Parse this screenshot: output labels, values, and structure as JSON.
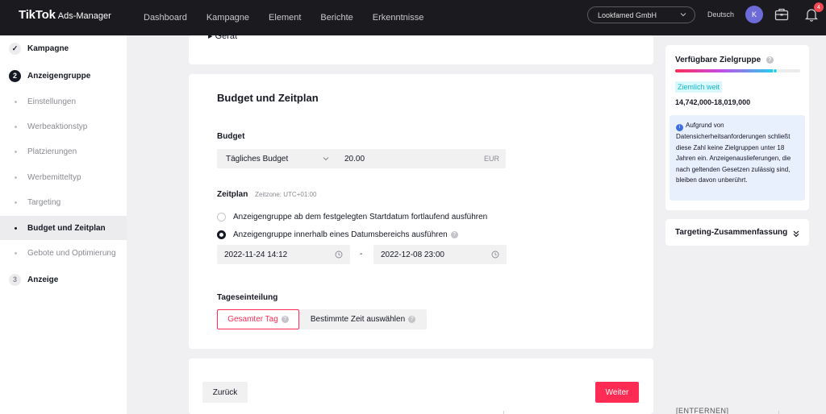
{
  "header": {
    "brand": "TikTok",
    "product": "Ads-Manager",
    "nav": [
      "Dashboard",
      "Kampagne",
      "Element",
      "Berichte",
      "Erkenntnisse"
    ],
    "account": "Lookfamed GmbH",
    "language": "Deutsch",
    "avatar_initial": "K",
    "notification_count": "4"
  },
  "sidebar": {
    "steps": [
      {
        "label": "Kampagne",
        "marker": "✓"
      },
      {
        "label": "Anzeigengruppe",
        "marker": "2"
      },
      {
        "label": "Einstellungen"
      },
      {
        "label": "Werbeaktionstyp"
      },
      {
        "label": "Platzierungen"
      },
      {
        "label": "Werbemitteltyp"
      },
      {
        "label": "Targeting"
      },
      {
        "label": "Budget und Zeitplan"
      },
      {
        "label": "Gebote und Optimierung"
      },
      {
        "label": "Anzeige",
        "marker": "3"
      }
    ]
  },
  "main": {
    "previous_section_item": "Gerät",
    "section_title": "Budget und Zeitplan",
    "budget": {
      "label": "Budget",
      "type": "Tägliches Budget",
      "amount": "20.00",
      "currency": "EUR"
    },
    "schedule": {
      "label": "Zeitplan",
      "timezone": "Zeitzone: UTC+01:00",
      "option_continuous": "Anzeigengruppe ab dem festgelegten Startdatum fortlaufend ausführen",
      "option_range": "Anzeigengruppe innerhalb eines Datumsbereichs ausführen",
      "selected": "range",
      "start": "2022-11-24 14:12",
      "separator": "-",
      "end": "2022-12-08 23:00"
    },
    "dayparting": {
      "label": "Tageseinteilung",
      "option_all_day": "Gesamter Tag",
      "option_specific": "Bestimmte Zeit auswählen"
    },
    "footer": {
      "back": "Zurück",
      "next": "Weiter"
    }
  },
  "right_panel": {
    "audience_title": "Verfügbare Zielgruppe",
    "audience_level": 0.8,
    "audience_tag": "Ziemlich weit",
    "audience_range": "14,742,000-18,019,000",
    "info_text": "Aufgrund von Datensicherheitsanforderungen schließt diese Zahl keine Zielgruppen unter 18 Jahren ein. Anzeigenauslieferungen, die nach geltenden Gesetzen zulässig sind, bleiben davon unberührt.",
    "summary_title": "Targeting-Zusammenfassung",
    "bottom_fragment": "[ENTFERNEN]"
  },
  "colors": {
    "accent": "#fe2c55",
    "topbar": "#1b1b1f",
    "info_bg": "#e8f0fd",
    "tag_text": "#0fb9cf"
  }
}
